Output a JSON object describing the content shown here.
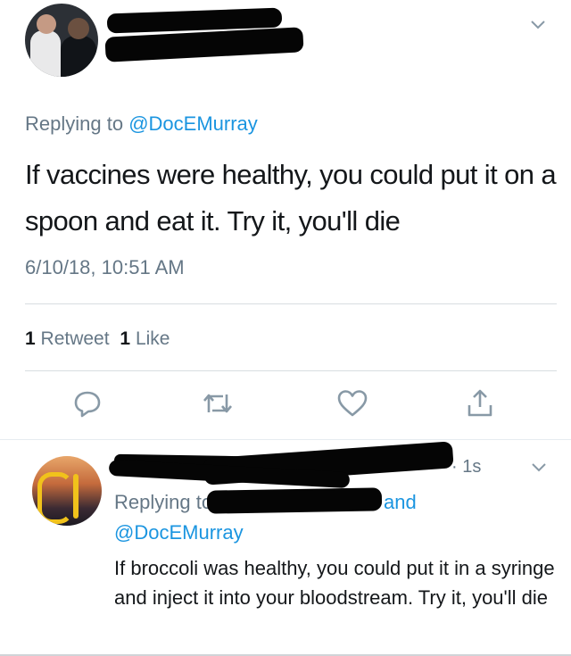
{
  "main_tweet": {
    "replying_prefix": "Replying to ",
    "replying_handle": "@DocEMurray",
    "text": "If vaccines were healthy, you could put it on a spoon and eat it. Try it, you'll die",
    "timestamp": "6/10/18, 10:51 AM",
    "stats": {
      "retweet_count": "1",
      "retweet_label": "Retweet",
      "like_count": "1",
      "like_label": "Like"
    },
    "actions": {
      "reply_icon": "reply-icon",
      "retweet_icon": "retweet-icon",
      "like_icon": "heart-icon",
      "share_icon": "share-icon"
    }
  },
  "reply_tweet": {
    "time": "· 1s",
    "replying_prefix": "Replying to",
    "replying_and": "and",
    "replying_handle": "@DocEMurray",
    "text": "If broccoli was healthy, you could put it in a syringe and inject it into your bloodstream. Try it, you'll die"
  },
  "colors": {
    "text": "#14171a",
    "muted": "#657786",
    "link": "#1b95e0",
    "divider": "#d8dde1",
    "redaction": "#050505"
  }
}
